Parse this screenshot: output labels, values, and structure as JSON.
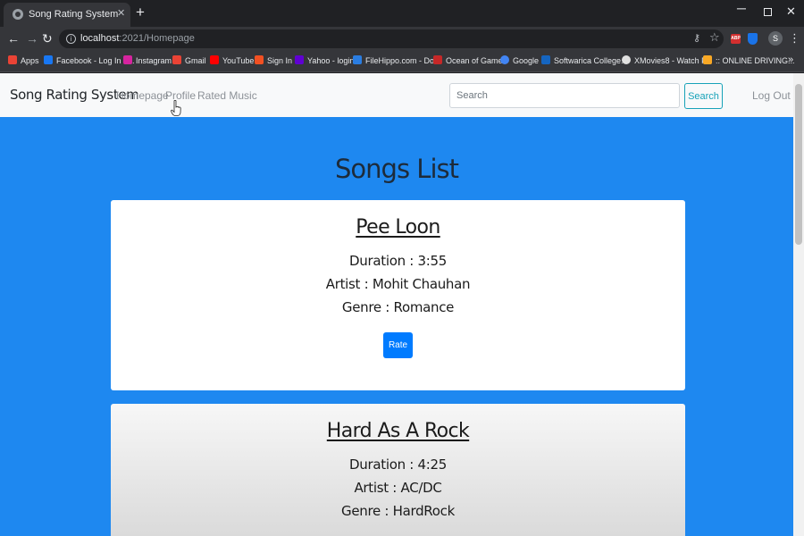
{
  "browser": {
    "tab_title": "Song Rating System",
    "url_host": "localhost",
    "url_path": ":2021/Homepage",
    "profile_initial": "S",
    "extension_abp": "ABP",
    "bookmarks": [
      {
        "label": "Apps",
        "color": "#ea4335"
      },
      {
        "label": "Facebook - Log In o...",
        "color": "#1877f2"
      },
      {
        "label": "Instagram",
        "color": "#d6249f"
      },
      {
        "label": "Gmail",
        "color": "#ea4335"
      },
      {
        "label": "YouTube",
        "color": "#ff0000"
      },
      {
        "label": "Sign In",
        "color": "#f25022"
      },
      {
        "label": "Yahoo - login",
        "color": "#6001d2"
      },
      {
        "label": "FileHippo.com - Do...",
        "color": "#2a7de1"
      },
      {
        "label": "Ocean of Games",
        "color": "#c62828"
      },
      {
        "label": "Google",
        "color": "#4285f4"
      },
      {
        "label": "Softwarica College...",
        "color": "#1565c0"
      },
      {
        "label": "XMovies8 - Watch F...",
        "color": "#e0e0e0"
      },
      {
        "label": ":: ONLINE DRIVING...",
        "color": "#f9a825"
      }
    ]
  },
  "site": {
    "brand": "Song Rating System",
    "nav_links": [
      "Homepage",
      "Profile",
      "Rated Music"
    ],
    "search_placeholder": "Search",
    "search_button": "Search",
    "logout": "Log Out"
  },
  "main": {
    "title": "Songs List",
    "songs": [
      {
        "name": "Pee Loon",
        "duration": "Duration : 3:55",
        "artist": "Artist : Mohit Chauhan",
        "genre": "Genre : Romance",
        "rate_label": "Rate"
      },
      {
        "name": "Hard As A Rock",
        "duration": "Duration : 4:25",
        "artist": "Artist : AC/DC",
        "genre": "Genre : HardRock"
      }
    ]
  },
  "colors": {
    "accent": "#1e88f0",
    "rate_button": "#007bff",
    "search_outline": "#17a2b8"
  }
}
